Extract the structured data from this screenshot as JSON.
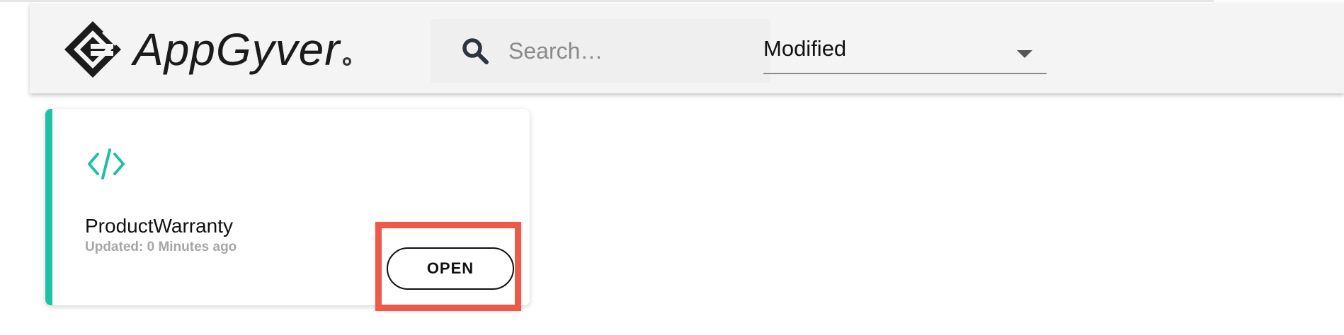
{
  "header": {
    "brand": "AppGyver",
    "search": {
      "placeholder": "Search…",
      "value": ""
    },
    "sort": {
      "selected": "Modified"
    }
  },
  "projects": [
    {
      "title": "ProductWarranty",
      "updated": "Updated: 0 Minutes ago",
      "action_label": "OPEN",
      "icon": "code-icon"
    }
  ],
  "colors": {
    "accent": "#1ec0a6",
    "highlight": "#ee5a4a",
    "header_bg": "#f4f4f4",
    "muted_text": "#a6a6a6"
  }
}
